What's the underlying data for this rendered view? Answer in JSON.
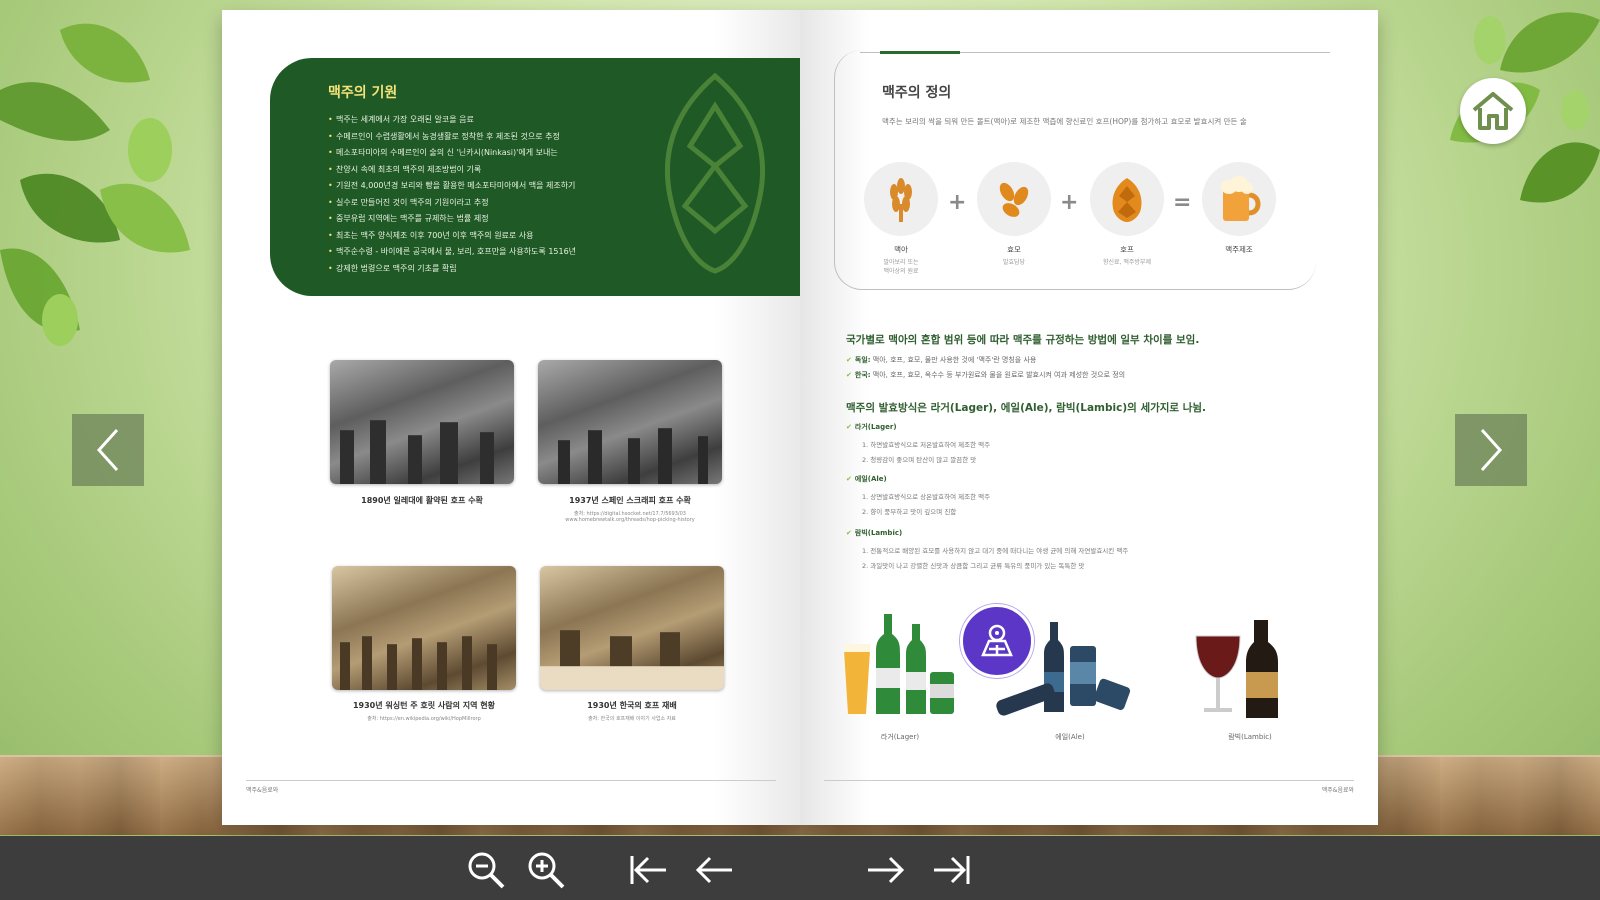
{
  "app": {
    "home_label": "home",
    "prev_label": "previous page",
    "next_label": "next page"
  },
  "toolbar": {
    "zoom_out": "zoom-out",
    "zoom_in": "zoom-in",
    "first_page": "first-page",
    "prev_page": "prev-page",
    "next_page": "next-page",
    "last_page": "last-page"
  },
  "left_page": {
    "origin": {
      "title": "맥주의 기원",
      "items": [
        "맥주는 세계에서 가장 오래된 알코올 음료",
        "수메르인이 수렵생활에서 농경생활로 정착한 후 제조된 것으로 추정",
        "메소포타미아의 수메르인이 술의 신 '닌카시(Ninkasi)'에게 보내는",
        "찬양시 속에 최초의 맥주의 제조방법이 기록",
        "기원전 4,000년경 보리와 빵을 활용한 메소포타미아에서 맥을 제조하기",
        "실수로 만들어진 것이 맥주의 기원이라고 추정",
        "중부유럽 지역에는 맥주를 규제하는 법률 제정",
        "최초는 맥주 양식제조 이후 700년 이후 맥주의 원료로 사용",
        "맥주순수령 - 바이에른 공국에서 물, 보리, 호프만을 사용하도록 1516년",
        "강제한 법령으로 맥주의 기초를 확립"
      ]
    },
    "photos": [
      {
        "caption": "1890년 일레대에 활약된 호프 수확",
        "sub": ""
      },
      {
        "caption": "1937년 스페인 스크래피 호프 수확",
        "sub": "출처: https://digital.hsocket.net/17.7/5693/03 www.homebrewtalk.org/threads/hop-picking-history"
      },
      {
        "caption": "1930년 워싱턴 주 호릿 사람의 지역 현황",
        "sub": "출처: https://en.wikipedia.org/wiki/HopMillrorp"
      },
      {
        "caption": "1930년 한국의 호프 재배",
        "sub": "출처: 한국의 호프재배 이야기 사업소 자료"
      }
    ],
    "footer": "맥주&음료와"
  },
  "right_page": {
    "definition": {
      "title": "맥주의 정의",
      "desc": "맥주는 보리의 싹을 틔워 만든 몰트(맥아)로 제조한 액즙에 향신료인 호프(HOP)를 첨가하고 효모로 발효시켜 만든 술",
      "ingredients": [
        {
          "name": "맥아",
          "sub": "발아보리 또는\n맥아상의 원료",
          "icon": "wheat-icon"
        },
        {
          "name": "효모",
          "sub": "발효담당",
          "icon": "yeast-icon"
        },
        {
          "name": "호프",
          "sub": "향신료, 맥주방부제",
          "icon": "hop-icon"
        },
        {
          "name": "맥주제조",
          "sub": "",
          "icon": "beer-mug-icon"
        }
      ]
    },
    "heading1": "국가별로 맥아의 혼합 범위 등에 따라 맥주를 규정하는 방법에 일부 차이를 보임.",
    "checks1": [
      {
        "key": "독일:",
        "text": " 맥아, 호프, 효모, 물만 사용한 것에 '맥주'란 명칭을 사용"
      },
      {
        "key": "한국:",
        "text": " 맥아, 호프, 효모, 옥수수 등 부가원료와 물을 원료로 발효시켜 여과 제성한 것으로 정의"
      }
    ],
    "heading2": "맥주의 발효방식은 라거(Lager), 에일(Ale), 람빅(Lambic)의 세가지로 나뉨.",
    "types": [
      {
        "name": "라거(Lager)",
        "lines": [
          "1. 하면발효방식으로 저온발효하여 제조한 맥주",
          "2. 청량감이 좋으며 탄산이 많고 깔끔한 맛"
        ]
      },
      {
        "name": "에일(Ale)",
        "lines": [
          "1. 상면발효방식으로 상온발효하여 제조한 맥주",
          "2. 향이 풍부하고 맛이 깊으며 진함"
        ]
      },
      {
        "name": "람빅(Lambic)",
        "lines": [
          "1. 전통적으로 배양된 효모를 사용하지 않고 대기 중에 떠다니는 야생 균에 의해 자연발효시킨 맥주",
          "2. 과일맛이 나고 강렬한 신맛과 상큼함 그리고 균류 특유의 풍미가 있는 독특한 맛"
        ]
      }
    ],
    "products": [
      {
        "caption": "라거(Lager)"
      },
      {
        "caption": "에일(Ale)"
      },
      {
        "caption": "람빅(Lambic)"
      }
    ],
    "footer": "맥주&음료와"
  }
}
